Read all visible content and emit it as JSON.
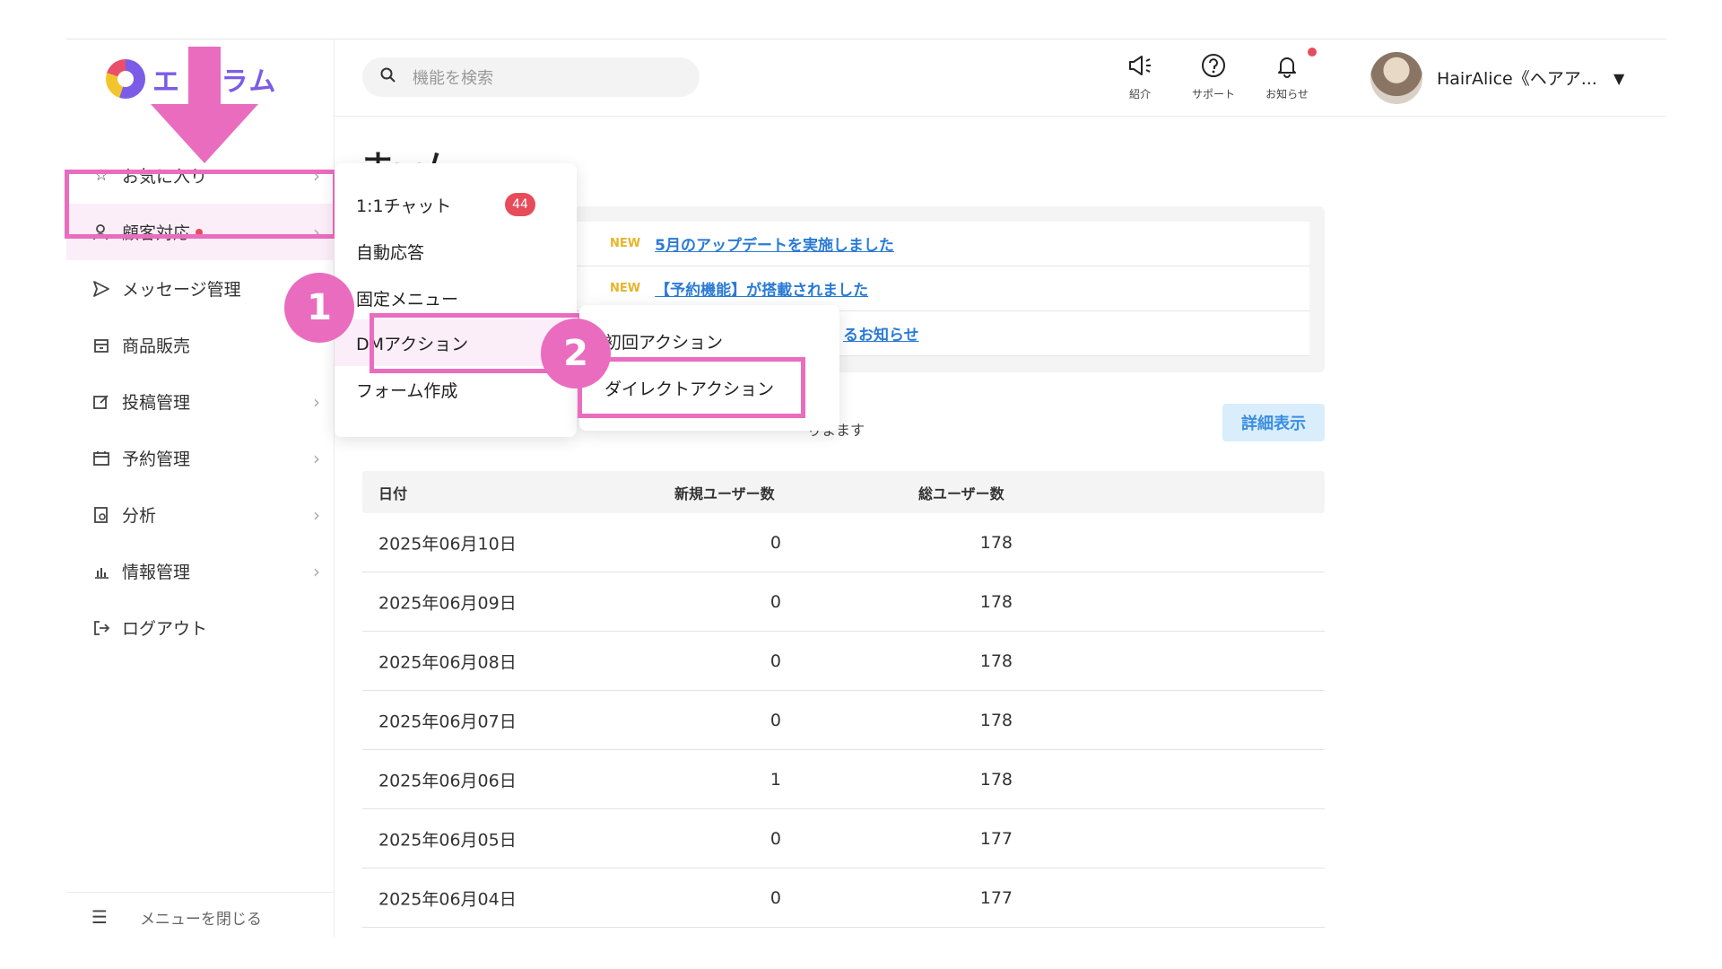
{
  "app": {
    "logo_text": "エ  グラム"
  },
  "search": {
    "placeholder": "機能を検索"
  },
  "header": {
    "intro_label": "紹介",
    "support_label": "サポート",
    "notifications_label": "お知らせ",
    "user_name": "HairAlice《ヘアア..."
  },
  "sidebar": {
    "items": [
      {
        "label": "お気に入り",
        "icon": "star-icon"
      },
      {
        "label": "顧客対応",
        "icon": "user-icon"
      },
      {
        "label": "メッセージ管理",
        "icon": "send-icon"
      },
      {
        "label": "商品販売",
        "icon": "store-icon"
      },
      {
        "label": "投稿管理",
        "icon": "edit-icon"
      },
      {
        "label": "予約管理",
        "icon": "calendar-icon"
      },
      {
        "label": "分析",
        "icon": "report-icon"
      },
      {
        "label": "情報管理",
        "icon": "bar-chart-icon"
      },
      {
        "label": "ログアウト",
        "icon": "logout-icon"
      }
    ],
    "close_label": "メニューを閉じる"
  },
  "main": {
    "title": "ホーム",
    "news": [
      {
        "tag": "NEW",
        "text": "5月のアップデートを実施しました"
      },
      {
        "tag": "NEW",
        "text": "【予約機能】が搭載されました"
      },
      {
        "tag": "",
        "text": "るお知らせ"
      }
    ],
    "caption": "りまます",
    "detail_button": "詳細表示",
    "table": {
      "headers": [
        "日付",
        "新規ユーザー数",
        "総ユーザー数"
      ],
      "rows": [
        [
          "2025年06月10日",
          "0",
          "178"
        ],
        [
          "2025年06月09日",
          "0",
          "178"
        ],
        [
          "2025年06月08日",
          "0",
          "178"
        ],
        [
          "2025年06月07日",
          "0",
          "178"
        ],
        [
          "2025年06月06日",
          "1",
          "178"
        ],
        [
          "2025年06月05日",
          "0",
          "177"
        ],
        [
          "2025年06月04日",
          "0",
          "177"
        ]
      ]
    }
  },
  "submenu": {
    "items": [
      {
        "label": "1:1チャット",
        "badge": "44"
      },
      {
        "label": "自動応答"
      },
      {
        "label": "固定メニュー"
      },
      {
        "label": "DMアクション"
      },
      {
        "label": "フォーム作成"
      }
    ]
  },
  "dm_submenu": {
    "items": [
      {
        "label": "初回アクション"
      },
      {
        "label": "ダイレクトアクション"
      }
    ]
  },
  "annotations": {
    "step1": "1",
    "step2": "2",
    "highlight_color": "#ea6cbf"
  }
}
